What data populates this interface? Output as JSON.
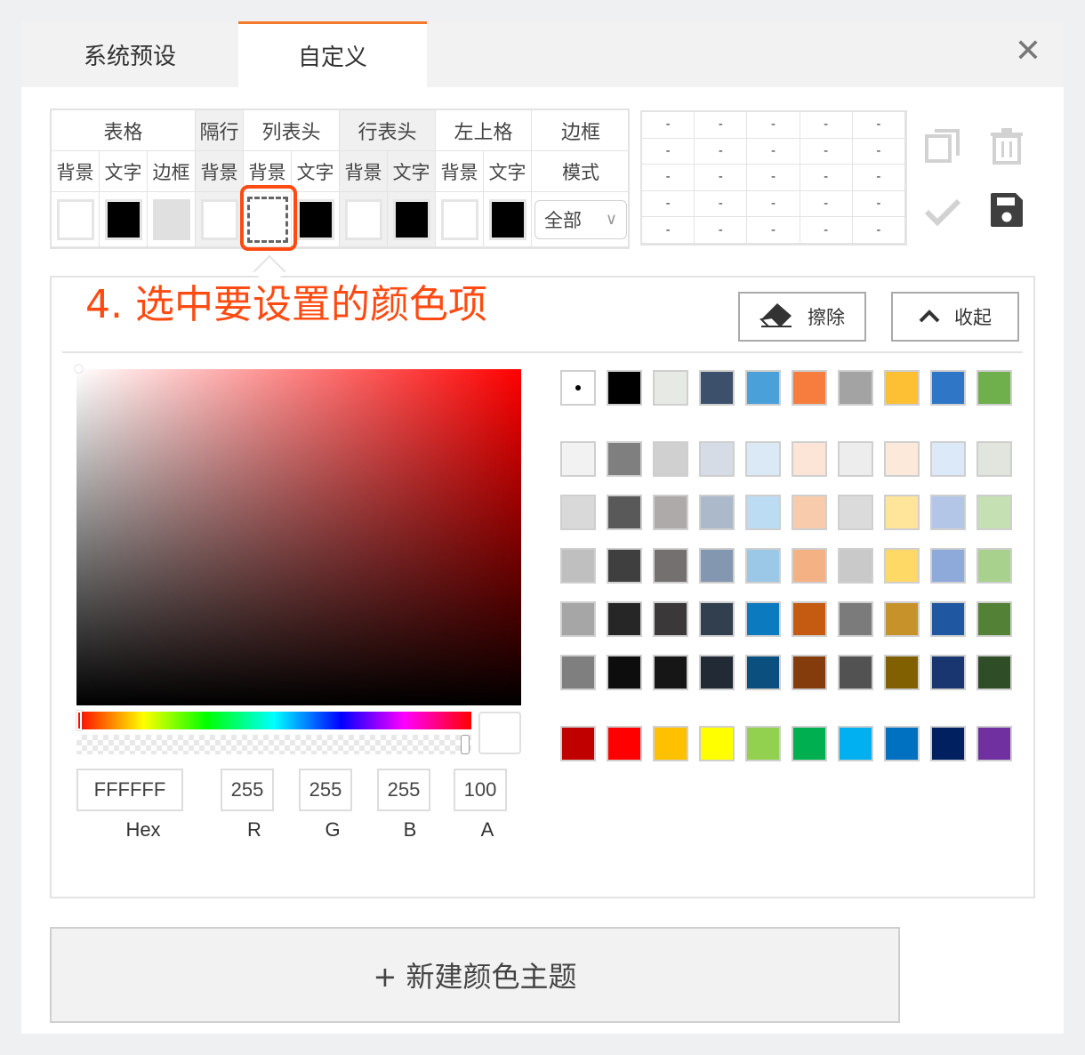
{
  "tabs": {
    "preset": "系统预设",
    "custom": "自定义"
  },
  "header_table": {
    "groups": [
      "表格",
      "隔行",
      "列表头",
      "行表头",
      "左上格",
      "边框"
    ],
    "sub_labels": [
      "背景",
      "文字",
      "边框",
      "背景",
      "背景",
      "文字",
      "背景",
      "文字",
      "背景",
      "文字",
      "模式"
    ],
    "mode_value": "全部"
  },
  "preview_cell": "-",
  "annotation": "4. 选中要设置的颜色项",
  "buttons": {
    "erase": "擦除",
    "collapse": "收起",
    "new_theme": "+ 新建颜色主题"
  },
  "picker": {
    "hex": "FFFFFF",
    "r": "255",
    "g": "255",
    "b": "255",
    "a": "100",
    "labels": {
      "hex": "Hex",
      "r": "R",
      "g": "G",
      "b": "B",
      "a": "A"
    }
  },
  "icons": {
    "close": "close-icon",
    "copy": "copy-icon",
    "delete": "trash-icon",
    "confirm": "check-icon",
    "save": "save-icon",
    "erase": "eraser-icon",
    "collapse": "chevron-up-icon"
  },
  "header_swatch_colors": [
    "#ffffff",
    "#000000",
    "#e0e0e0",
    "#ffffff",
    "#ffffff",
    "#000000",
    "#ffffff",
    "#000000",
    "#ffffff",
    "#000000"
  ],
  "palette": [
    [
      "#ffffff",
      "#000000",
      "#e7e9e5",
      "#3c4f6b",
      "#4aa0d8",
      "#f77d3f",
      "#a3a3a3",
      "#fdc035",
      "#2f76c6",
      "#6fb04c"
    ],
    [
      "#f2f2f2",
      "#7f7f7f",
      "#d0d0d0",
      "#d6dce5",
      "#dbe9f7",
      "#fce4d6",
      "#ededed",
      "#fde9d9",
      "#dce9f8",
      "#e2e5de"
    ],
    [
      "#d9d9d9",
      "#595959",
      "#aeaaaa",
      "#acb9ca",
      "#bcdcf3",
      "#f8cbad",
      "#dbdbdb",
      "#ffe599",
      "#b4c6e7",
      "#c5e0b3"
    ],
    [
      "#bfbfbf",
      "#3f3f3f",
      "#757070",
      "#8497b0",
      "#9bc8e6",
      "#f4b183",
      "#c9c9c9",
      "#ffd966",
      "#8eaadb",
      "#a9d18e"
    ],
    [
      "#a6a6a6",
      "#262626",
      "#3a3838",
      "#323f4f",
      "#0c7abf",
      "#c55a11",
      "#7b7b7b",
      "#c8922b",
      "#1f58a0",
      "#538135"
    ],
    [
      "#7f7f7f",
      "#0d0d0d",
      "#171616",
      "#222a35",
      "#0a4f7d",
      "#843c0c",
      "#525252",
      "#806000",
      "#1a3670",
      "#2f4d26"
    ],
    [
      "#c00000",
      "#ff0000",
      "#ffc000",
      "#ffff00",
      "#92d050",
      "#00b050",
      "#00b0f0",
      "#0070c0",
      "#002060",
      "#7030a0"
    ]
  ],
  "colors": {
    "accent": "#f57a2c",
    "annotation": "#ff4b12"
  }
}
